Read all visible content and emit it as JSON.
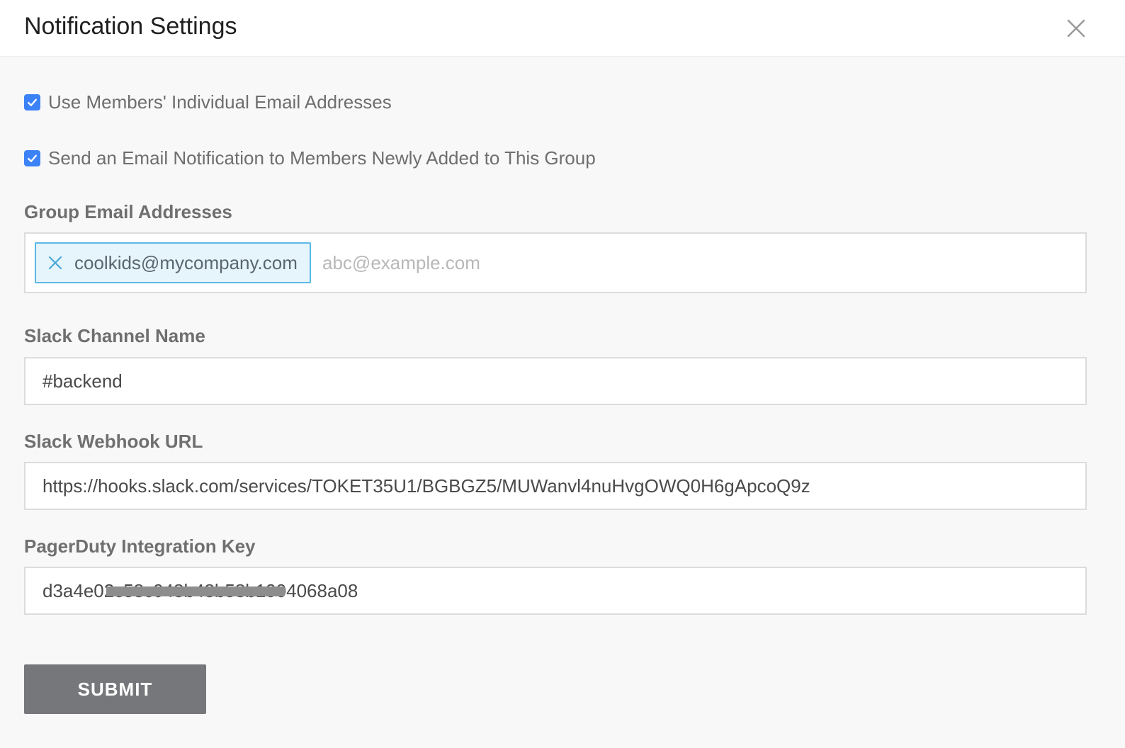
{
  "header": {
    "title": "Notification Settings"
  },
  "options": {
    "use_individual_emails": {
      "label": "Use Members' Individual Email Addresses",
      "checked": true
    },
    "notify_new_members": {
      "label": "Send an Email Notification to Members Newly Added to This Group",
      "checked": true
    }
  },
  "group_email": {
    "label": "Group Email Addresses",
    "tags": [
      "coolkids@mycompany.com"
    ],
    "placeholder": "abc@example.com"
  },
  "slack_channel": {
    "label": "Slack Channel Name",
    "value": "#backend"
  },
  "slack_webhook": {
    "label": "Slack Webhook URL",
    "value": "https://hooks.slack.com/services/TOKET35U1/BGBGZ5/MUWanvl4nuHvgOWQ0H6gApcoQ9z"
  },
  "pagerduty": {
    "label": "PagerDuty Integration Key",
    "value": "d3a4e02c58c048b48b58b1904068a08"
  },
  "actions": {
    "submit_label": "SUBMIT"
  },
  "colors": {
    "accent": "#3b82f6",
    "tag_border": "#5cb8e6",
    "tag_bg": "#e6f4fb",
    "submit_bg": "#76777a"
  }
}
